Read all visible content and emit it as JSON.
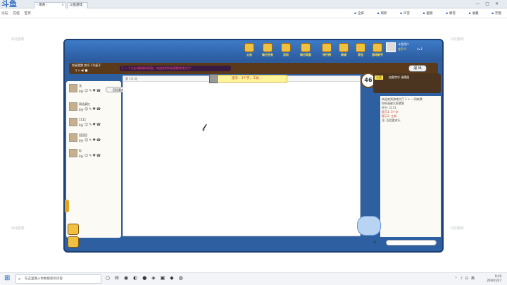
{
  "browser": {
    "logo": "斗鱼",
    "tabs": [
      {
        "label": "- 谢谢 -"
      },
      {
        "label": "斗鱼游戏"
      }
    ],
    "subnav": [
      "论坛",
      "充值",
      "首页"
    ],
    "tools": [
      "全屏",
      "刷新",
      "声音",
      "截图",
      "静音",
      "收藏",
      "存图"
    ]
  },
  "game": {
    "menu": [
      {
        "label": "公告"
      },
      {
        "label": "每日任务"
      },
      {
        "label": "活动"
      },
      {
        "label": "每日奖励"
      },
      {
        "label": "排行榜"
      },
      {
        "label": "商城"
      },
      {
        "label": "背包"
      },
      {
        "label": "游戏新手"
      }
    ],
    "user": {
      "name": "斗鱼用户",
      "coins": "金币 0",
      "level": "Lv.1"
    },
    "room": {
      "line1": "你画我猜 房间 1号桌子",
      "line2": "♫ ⌂ ◀) ■"
    },
    "marquee": "1 ～ 1 点击领取福利奖励，欢迎来到你画我猜游戏大厅！",
    "exit_label": "退 出",
    "hint": {
      "label": "提示：3个字，工具"
    },
    "canvas_top": "第 1/1 轮",
    "timer": "46",
    "players": [
      {
        "name": "法",
        "score": "0分",
        "bubble": "回话喜欢乐"
      },
      {
        "name": "周佳豪忆",
        "score": "0分",
        "bubble": ""
      },
      {
        "name": "1111",
        "score": "0分",
        "bubble": ""
      },
      {
        "name": "回回回",
        "score": "0分",
        "bubble": ""
      },
      {
        "name": "6j",
        "score": "0分",
        "bubble": ""
      }
    ],
    "chat_top": {
      "label": "公告",
      "msg": "加载完毕 请猜图"
    },
    "chat_log": [
      {
        "text": "欢迎来到游戏大厅 1 + 一同来猜",
        "red": false
      },
      {
        "text": "你的画被大家猜到",
        "red": false
      },
      {
        "text": "房主: 1111",
        "red": false
      },
      {
        "text": "提示1: 3个字",
        "red": true
      },
      {
        "text": "提示2: 工具",
        "red": true
      },
      {
        "text": "法: 回话喜欢乐",
        "red": false
      }
    ]
  },
  "taskbar": {
    "search_placeholder": "在这里输入你要搜索的内容",
    "time": "9:10",
    "date": "2020/1/27"
  },
  "watermark": "QQ游戏"
}
